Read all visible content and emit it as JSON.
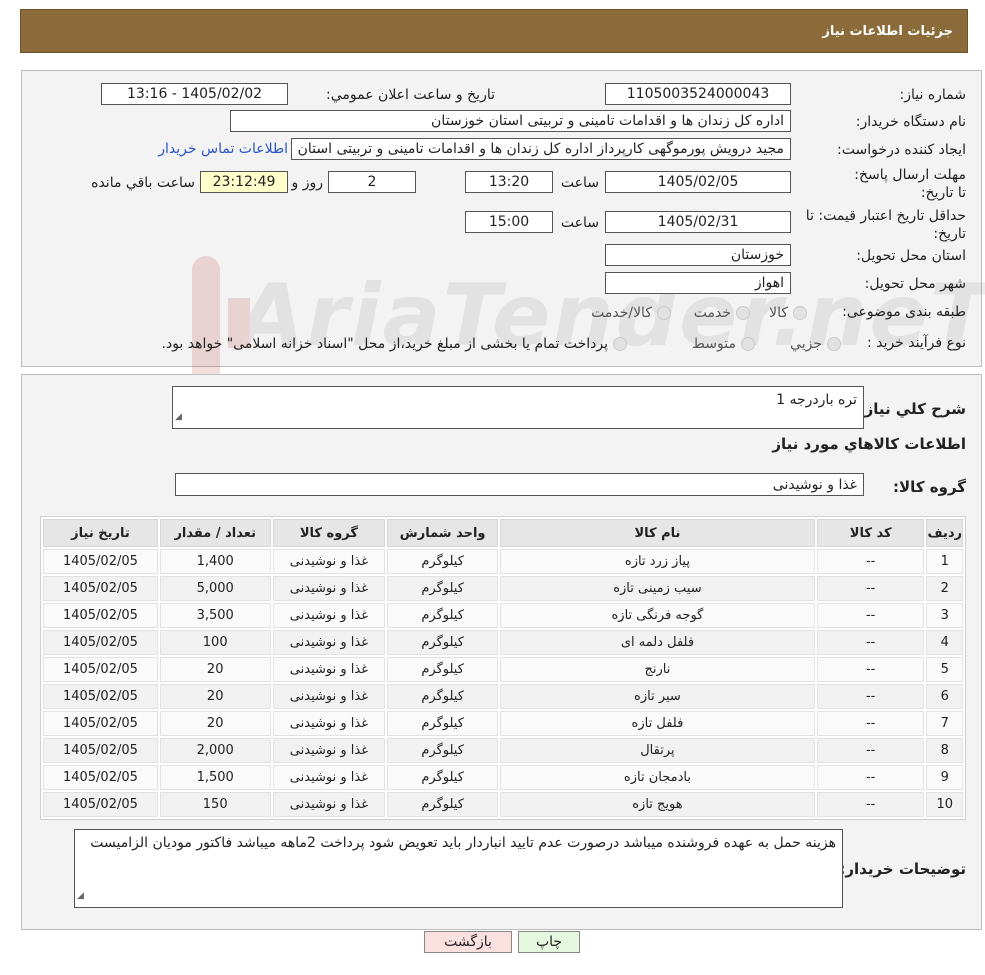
{
  "header": {
    "title": "جزئیات اطلاعات نیاز"
  },
  "form": {
    "need_number_label": "شماره نیاز:",
    "need_number": "1105003524000043",
    "announce_label": "تاریخ و ساعت اعلان عمومي:",
    "announce_value": "1405/02/02 - 13:16",
    "buyer_org_label": "نام دستگاه خريدار:",
    "buyer_org": "اداره کل زندان ها و اقدامات تامینی و تربیتی استان خوزستان",
    "creator_label": "ايجاد کننده درخواست:",
    "creator": "مجید درویش پورموگهی کارپرداز اداره کل زندان ها و اقدامات تامینی و تربیتی استان خوزستان",
    "contact_link": "اطلاعات تماس خریدار",
    "reply_deadline_label": "مهلت ارسال پاسخ: تا تاريخ:",
    "reply_date": "1405/02/05",
    "time_label": "ساعت",
    "reply_time": "13:20",
    "days_value": "2",
    "days_label": "روز و",
    "remaining_time": "23:12:49",
    "remaining_label": "ساعت باقي مانده",
    "price_validity_label": "حداقل تاريخ اعتبار قيمت: تا تاريخ:",
    "price_date": "1405/02/31",
    "price_time": "15:00",
    "province_label": "استان محل تحويل:",
    "province": "خوزستان",
    "city_label": "شهر محل تحويل:",
    "city": "اهواز",
    "category_label": "طبقه بندی موضوعی:",
    "category_options": [
      "کالا",
      "خدمت",
      "کالا/خدمت"
    ],
    "process_label": "نوع فرآيند خريد :",
    "process_options": [
      "جزيي",
      "متوسط"
    ],
    "process_note": "پرداخت تمام يا بخشی از مبلغ خريد،از محل \"اسناد خزانه اسلامی\" خواهد بود."
  },
  "summary": {
    "label": "شرح کلي نياز:",
    "value": "تره باردرجه 1",
    "goods_info_title": "اطلاعات کالاهاي مورد نياز",
    "group_label": "گروه کالا:",
    "group_value": "غذا و نوشیدنی"
  },
  "table": {
    "headers": [
      "رديف",
      "کد کالا",
      "نام کالا",
      "واحد شمارش",
      "گروه کالا",
      "تعداد / مقدار",
      "تاریخ نیاز"
    ],
    "rows": [
      [
        "1",
        "--",
        "پیاز زرد تازه",
        "کیلوگرم",
        "غذا و نوشیدنی",
        "1,400",
        "1405/02/05"
      ],
      [
        "2",
        "--",
        "سیب زمینی تازه",
        "کیلوگرم",
        "غذا و نوشیدنی",
        "5,000",
        "1405/02/05"
      ],
      [
        "3",
        "--",
        "گوجه فرنگی تازه",
        "کیلوگرم",
        "غذا و نوشیدنی",
        "3,500",
        "1405/02/05"
      ],
      [
        "4",
        "--",
        "فلفل دلمه ای",
        "کیلوگرم",
        "غذا و نوشیدنی",
        "100",
        "1405/02/05"
      ],
      [
        "5",
        "--",
        "نارنج",
        "کیلوگرم",
        "غذا و نوشیدنی",
        "20",
        "1405/02/05"
      ],
      [
        "6",
        "--",
        "سیر تازه",
        "کیلوگرم",
        "غذا و نوشیدنی",
        "20",
        "1405/02/05"
      ],
      [
        "7",
        "--",
        "فلفل تازه",
        "کیلوگرم",
        "غذا و نوشیدنی",
        "20",
        "1405/02/05"
      ],
      [
        "8",
        "--",
        "پرتقال",
        "کیلوگرم",
        "غذا و نوشیدنی",
        "2,000",
        "1405/02/05"
      ],
      [
        "9",
        "--",
        "بادمجان تازه",
        "کیلوگرم",
        "غذا و نوشیدنی",
        "1,500",
        "1405/02/05"
      ],
      [
        "10",
        "--",
        "هویج تازه",
        "کیلوگرم",
        "غذا و نوشیدنی",
        "150",
        "1405/02/05"
      ]
    ]
  },
  "buyer_notes": {
    "label": "توضيحات خريدار:",
    "value": "هزینه حمل به عهده فروشنده میباشد درصورت عدم تایید انباردار باید تعویض شود پرداخت 2ماهه میباشد فاکتور مودیان الزامیست"
  },
  "buttons": {
    "print": "چاپ",
    "back": "بازگشت"
  },
  "watermark": {
    "text": "AriaTender.neT"
  },
  "colors": {
    "header_bg": "#8b6b3a",
    "link": "#2a55c9",
    "back_button": "#fbe0e0",
    "print_button": "#e6f7e0",
    "timer_bg": "#ffffcc"
  }
}
